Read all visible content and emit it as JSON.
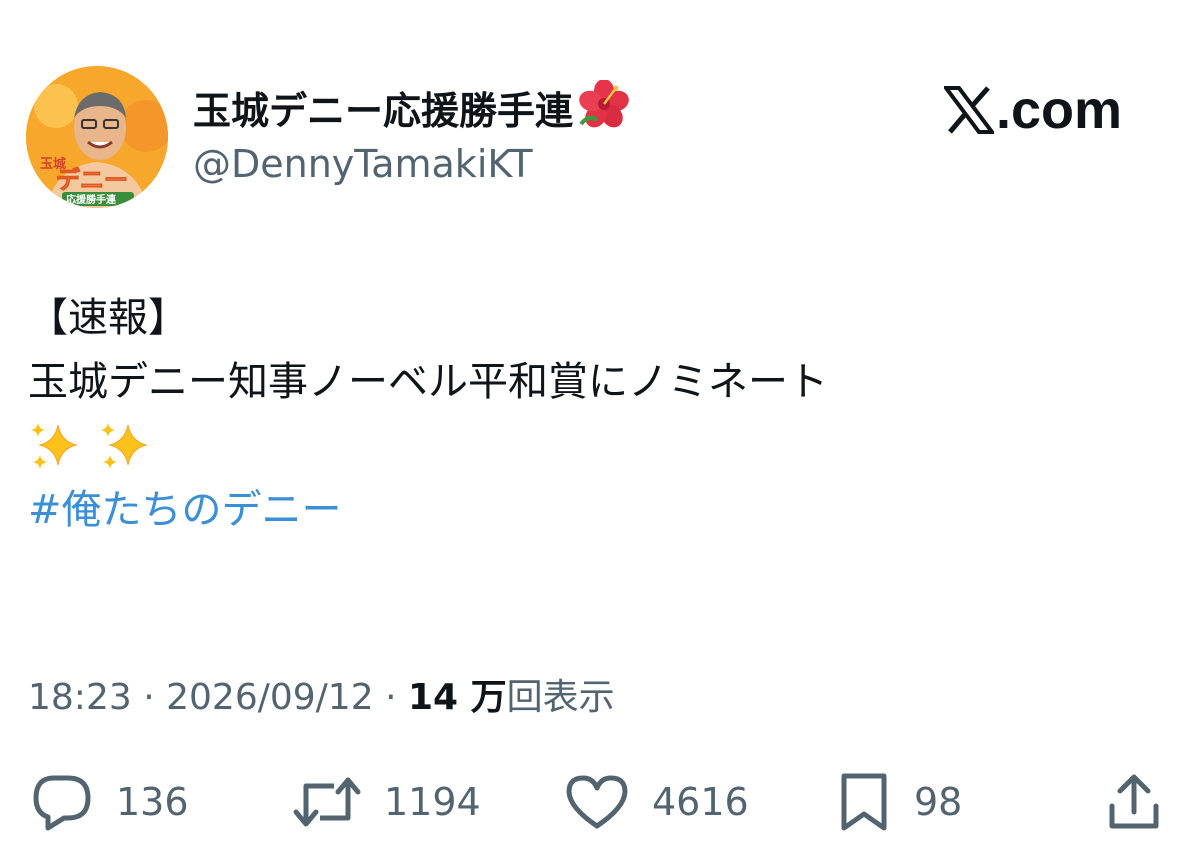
{
  "author": {
    "display_name": "玉城デニー応援勝手連",
    "name_emoji": "hibiscus",
    "handle": "@DennyTamakiKT",
    "avatar_label_top": "玉城",
    "avatar_label_main": "デニー",
    "avatar_label_bottom": "応援勝手連"
  },
  "brand": {
    "icon": "x-logo-icon",
    "text": ".com"
  },
  "tweet": {
    "lines": [
      "【速報】",
      "玉城デニー知事ノーベル平和賞にノミネート"
    ],
    "emoji": [
      "sparkles",
      "sparkles"
    ],
    "hashtag": "#俺たちのデニー"
  },
  "meta": {
    "time": "18:23",
    "separator": "·",
    "date": "2026/09/12",
    "views_count": "14 万",
    "views_label": "回表示"
  },
  "actions": {
    "replies": {
      "icon": "reply-icon",
      "count": "136"
    },
    "retweets": {
      "icon": "retweet-icon",
      "count": "1194"
    },
    "likes": {
      "icon": "heart-icon",
      "count": "4616"
    },
    "bookmarks": {
      "icon": "bookmark-icon",
      "count": "98"
    },
    "share": {
      "icon": "share-icon"
    }
  },
  "colors": {
    "text": "#0f1419",
    "secondary": "#536471",
    "hashtag": "#3b8fd6",
    "avatar_bg": "#f7a82c"
  }
}
